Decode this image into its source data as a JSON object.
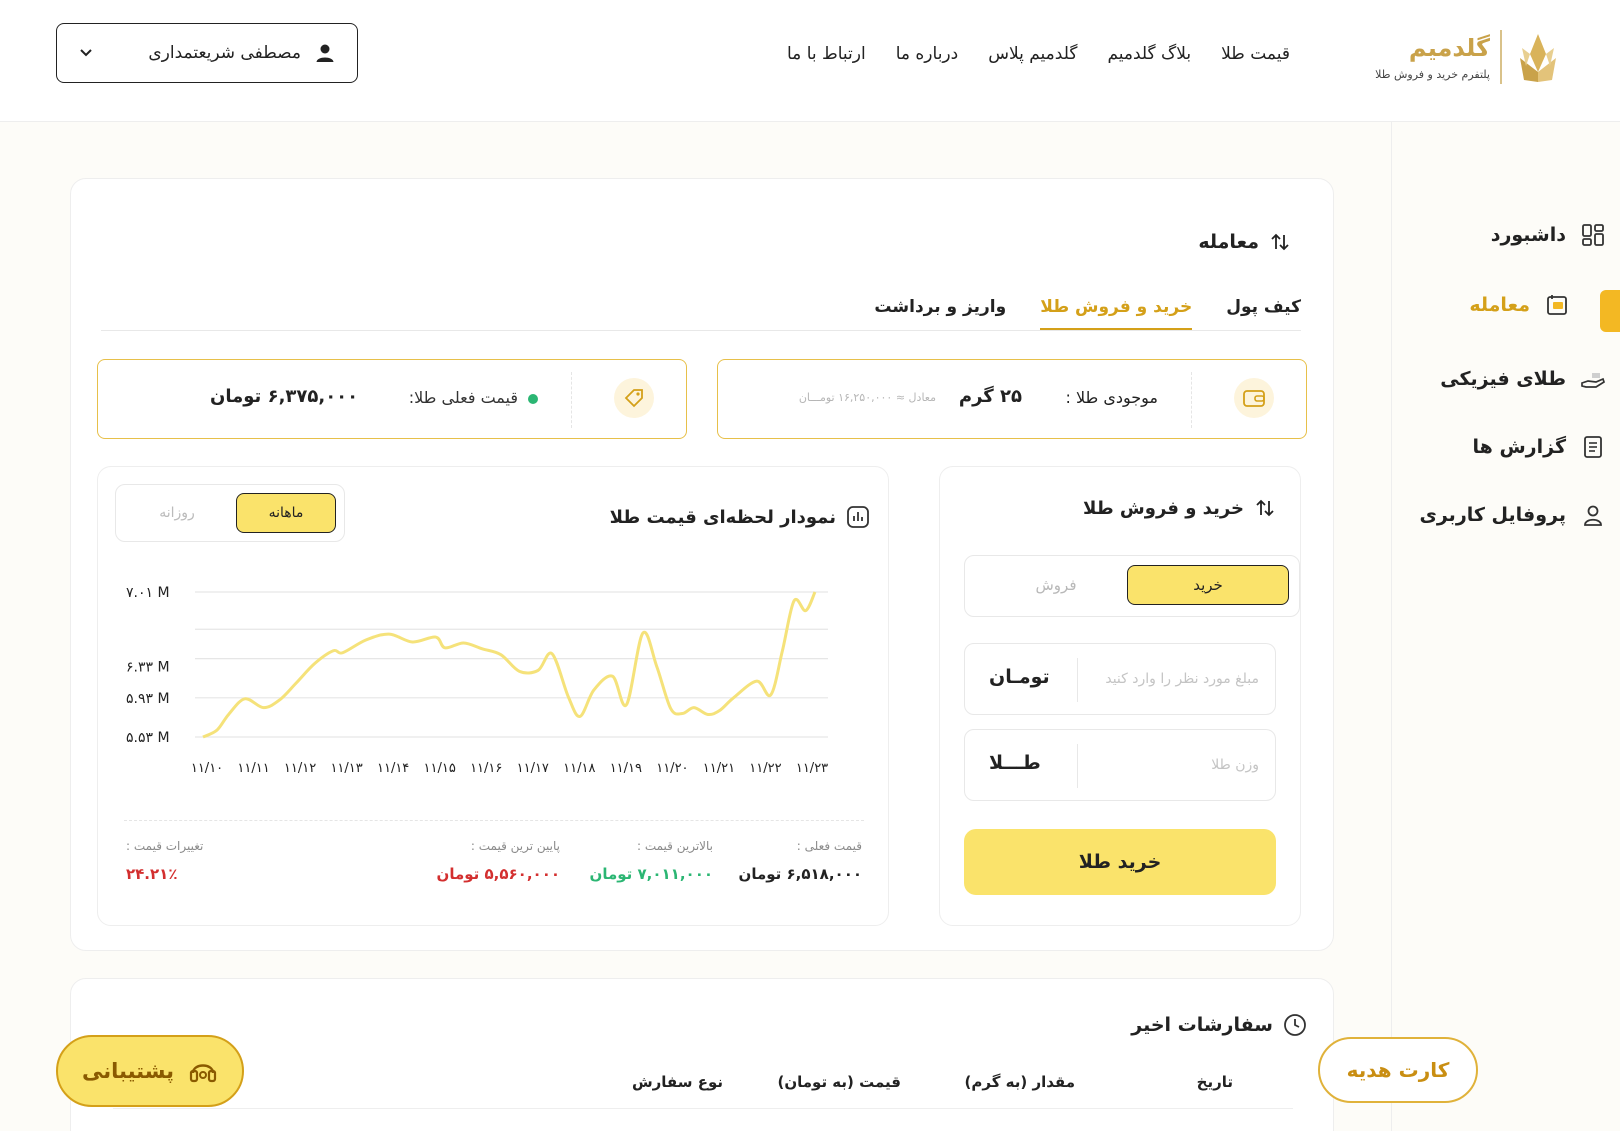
{
  "brand": {
    "name": "گلدمیم",
    "tagline": "پلتفرم خرید و فروش طلا"
  },
  "nav": {
    "items": [
      "قیمت طلا",
      "بلاگ گلدمیم",
      "گلدمیم پلاس",
      "درباره ما",
      "ارتباط با ما"
    ]
  },
  "user": {
    "name": "مصطفی شریعتمداری"
  },
  "sidebar": {
    "items": [
      {
        "label": "داشبورد",
        "icon": "grid-icon"
      },
      {
        "label": "معامله",
        "icon": "trade-icon"
      },
      {
        "label": "طلای فیزیکی",
        "icon": "hand-gold-icon"
      },
      {
        "label": "گزارش ها",
        "icon": "report-icon"
      },
      {
        "label": "پروفایل کاربری",
        "icon": "user-icon"
      }
    ]
  },
  "main": {
    "title": "معامله",
    "tabs": [
      "کیف پول",
      "خرید و فروش طلا",
      "واریز و برداشت"
    ]
  },
  "balance": {
    "label": "موجودی طلا :",
    "amount": "۲۵ گرم",
    "equivalent": "معادل ≈ ۱۶,۲۵۰,۰۰۰ تومـــان"
  },
  "price": {
    "label": "قیمت فعلی طلا:",
    "value": "۶,۳۷۵,۰۰۰ تومان"
  },
  "trade": {
    "title": "خرید و فروش طلا",
    "buy_tab": "خرید",
    "sell_tab": "فروش",
    "amount_placeholder": "مبلغ مورد نظر را وارد کنید",
    "amount_unit": "تومـان",
    "weight_placeholder": "وزن طلا",
    "weight_unit": "طـــلا",
    "submit": "خرید طلا"
  },
  "chart": {
    "title": "نمودار لحظه‌ای قیمت طلا",
    "period_active": "ماهانه",
    "period_inactive": "روزانه",
    "line_color": "#f5e27a"
  },
  "chart_data": {
    "type": "line",
    "title": "نمودار لحظه‌ای قیمت طلا",
    "categories": [
      "۱۱/۱۰",
      "۱۱/۱۱",
      "۱۱/۱۲",
      "۱۱/۱۳",
      "۱۱/۱۴",
      "۱۱/۱۵",
      "۱۱/۱۶",
      "۱۱/۱۷",
      "۱۱/۱۸",
      "۱۱/۱۹",
      "۱۱/۲۰",
      "۱۱/۲۱",
      "۱۱/۲۲",
      "۱۱/۲۳"
    ],
    "y_tick_labels": [
      "۷.۰۱ M",
      "۶.۳۳ M",
      "۵.۹۳ M",
      "۵.۵۳ M"
    ],
    "y_ticks": [
      7.01,
      6.63,
      6.33,
      5.93,
      5.53
    ],
    "ylim": [
      5.53,
      7.01
    ],
    "x": [
      0,
      0.3,
      0.55,
      0.9,
      1.3,
      1.65,
      2.0,
      2.4,
      2.8,
      3.0,
      3.5,
      4.0,
      4.5,
      5.0,
      5.2,
      5.6,
      6.0,
      6.4,
      6.8,
      7.2,
      7.5,
      7.85,
      8.1,
      8.4,
      8.8,
      9.1,
      9.45,
      9.75,
      10.05,
      10.3,
      10.55,
      10.85,
      11.1,
      11.4,
      11.9,
      12.2,
      12.45,
      12.7,
      12.95,
      13.15
    ],
    "values": [
      5.53,
      5.6,
      5.76,
      5.92,
      5.83,
      5.91,
      6.08,
      6.28,
      6.41,
      6.39,
      6.52,
      6.58,
      6.5,
      6.55,
      6.44,
      6.49,
      6.43,
      6.37,
      6.2,
      6.21,
      6.38,
      5.94,
      5.74,
      6.01,
      6.15,
      5.86,
      6.59,
      6.25,
      5.82,
      5.77,
      5.83,
      5.76,
      5.8,
      5.93,
      6.1,
      5.96,
      6.41,
      6.92,
      6.82,
      7.01
    ]
  },
  "stats": {
    "current_label": "قیمت فعلی :",
    "current_value": "۶,۵۱۸,۰۰۰ تومان",
    "high_label": "بالاترین قیمت :",
    "high_value": "۷,۰۱۱,۰۰۰ تومان",
    "low_label": "پایین ترین قیمت :",
    "low_value": "۵,۵۶۰,۰۰۰ تومان",
    "change_label": "تغییرات قیمت :",
    "change_value": "۲۴.۲۱٪",
    "colors": {
      "high": "#2bb673",
      "low": "#d32f2f",
      "change": "#d32f2f"
    }
  },
  "orders": {
    "title": "سفارشات اخیر",
    "columns": [
      "تاریخ",
      "مقدار (به گرم)",
      "قیمت (به تومان)",
      "نوع سفارش"
    ]
  },
  "support": {
    "label": "پشتیبانی"
  },
  "gift": {
    "label": "کارت هدیه"
  },
  "colors": {
    "accent": "#f3b823",
    "highlight": "#fae36b",
    "active_text": "#d4a019"
  }
}
